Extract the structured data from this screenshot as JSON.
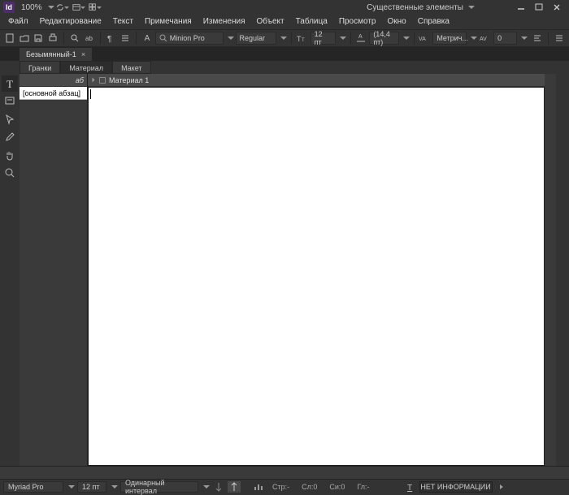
{
  "title": {
    "zoom": "100%",
    "workspace": "Существенные элементы"
  },
  "menu": [
    "Файл",
    "Редактирование",
    "Текст",
    "Примечания",
    "Изменения",
    "Объект",
    "Таблица",
    "Просмотр",
    "Окно",
    "Справка"
  ],
  "ctrl": {
    "font": "Minion Pro",
    "style": "Regular",
    "size": "12 пт",
    "leading": "(14,4 пт)",
    "kerning": "Метрич...",
    "tracking": "0"
  },
  "doc": {
    "tab": "Безымянный-1",
    "panelTabs": [
      "Гранки",
      "Материал",
      "Макет"
    ],
    "materialHead": "Материал 1",
    "paraStyle": "[основной абзац]",
    "storyHeadIcon": "аб"
  },
  "status": {
    "font": "Myriad Pro",
    "size": "12 пт",
    "leading": "Одинарный интервал",
    "str": "Стр:-",
    "sl": "Сл:0",
    "si": "Си:0",
    "gl": "Гл:-",
    "info": "НЕТ ИНФОРМАЦИИ"
  }
}
